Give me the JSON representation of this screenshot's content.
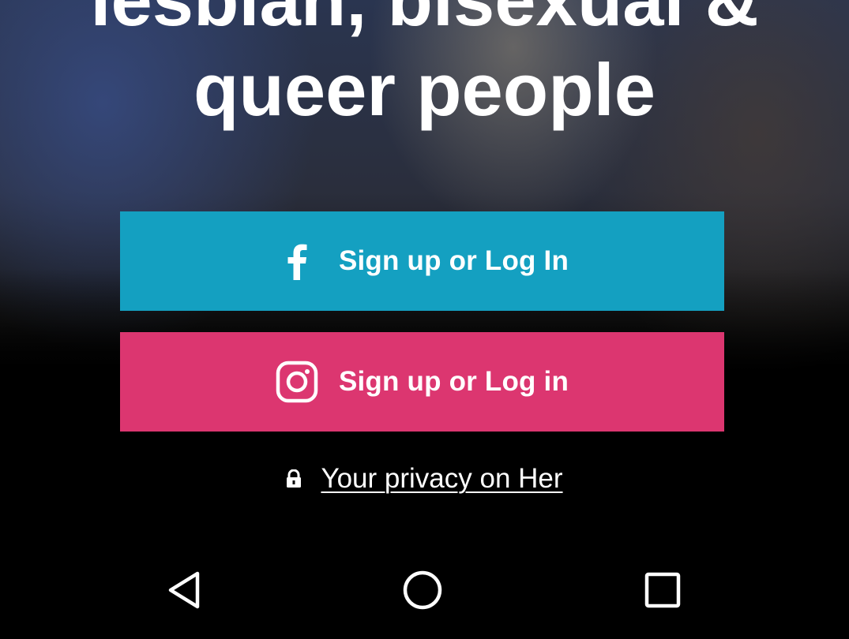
{
  "headline": {
    "line1": "lesbian, bisexual &",
    "line2": "queer people"
  },
  "buttons": {
    "facebook": {
      "label": "Sign up or Log In",
      "icon": "facebook-icon",
      "color": "#14a0c1"
    },
    "instagram": {
      "label": "Sign up or Log in",
      "icon": "instagram-icon",
      "color": "#dc3670"
    }
  },
  "privacy": {
    "icon": "lock-icon",
    "label": "Your privacy on Her"
  },
  "navbar": {
    "back_icon": "back-triangle-icon",
    "home_icon": "home-circle-icon",
    "recents_icon": "recents-square-icon"
  },
  "colors": {
    "background": "#000000",
    "text": "#ffffff"
  }
}
